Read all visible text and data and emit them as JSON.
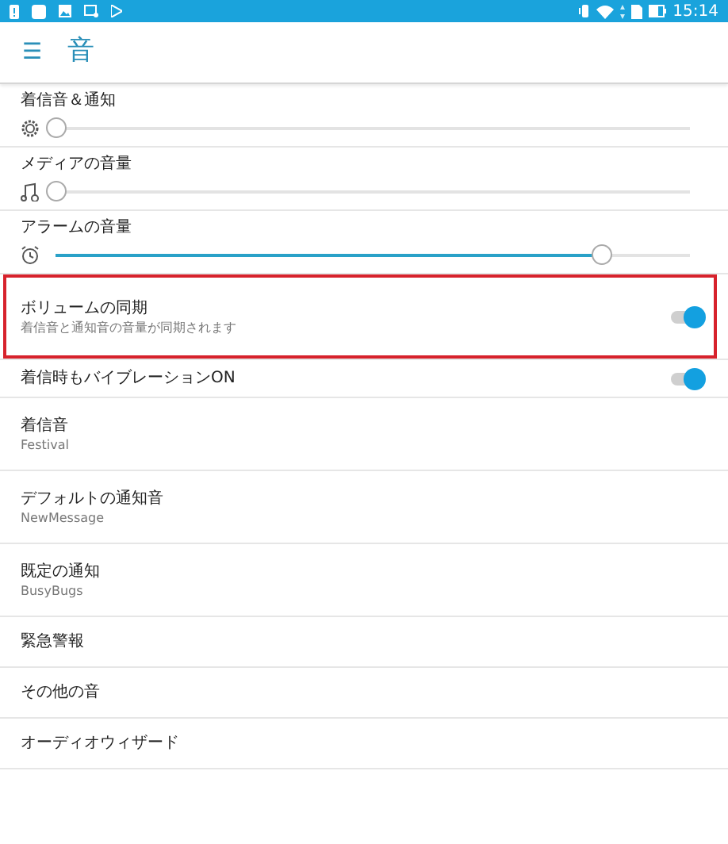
{
  "status_bar": {
    "time": "15:14"
  },
  "toolbar": {
    "menu_icon": "☰",
    "title": "音"
  },
  "volume_sliders": [
    {
      "label": "着信音＆通知",
      "level": 0
    },
    {
      "label": "メディアの音量",
      "level": 0
    },
    {
      "label": "アラームの音量",
      "level": 0.86
    }
  ],
  "settings": [
    {
      "kind": "toggle",
      "title": "ボリュームの同期",
      "summary": "着信音と通知音の音量が同期されます",
      "on": true,
      "highlighted": true
    },
    {
      "kind": "toggle",
      "title": "着信時もバイブレーションON",
      "on": true,
      "highlighted": false
    },
    {
      "kind": "item",
      "title": "着信音",
      "summary": "Festival"
    },
    {
      "kind": "item",
      "title": "デフォルトの通知音",
      "summary": "NewMessage"
    },
    {
      "kind": "item",
      "title": "既定の通知",
      "summary": "BusyBugs"
    },
    {
      "kind": "item",
      "title": "緊急警報"
    },
    {
      "kind": "item",
      "title": "その他の音"
    },
    {
      "kind": "item",
      "title": "オーディオウィザード"
    }
  ]
}
